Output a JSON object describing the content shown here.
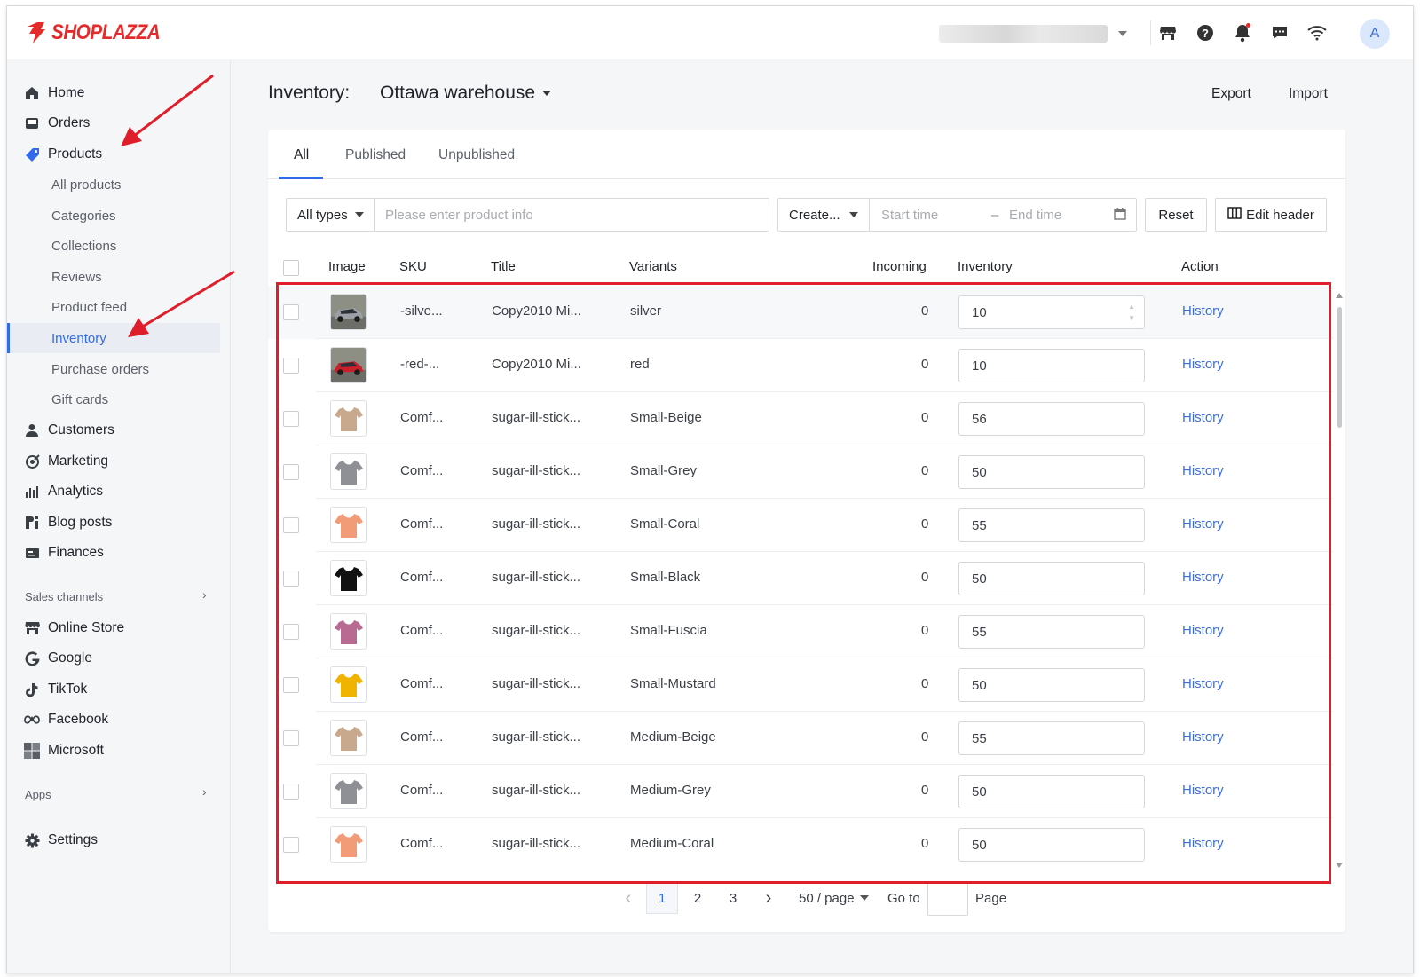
{
  "brand": {
    "name": "SHOPLAZZA",
    "color": "#e52a2a"
  },
  "topbar": {
    "icons": [
      "store-icon",
      "help-icon",
      "bell-icon",
      "chat-icon",
      "wifi-icon"
    ],
    "avatar_initial": "A"
  },
  "sidebar": {
    "main_items": [
      {
        "label": "Home",
        "icon": "home-icon"
      },
      {
        "label": "Orders",
        "icon": "orders-icon"
      },
      {
        "label": "Products",
        "icon": "tag-icon"
      }
    ],
    "product_sub_items": [
      {
        "label": "All products"
      },
      {
        "label": "Categories"
      },
      {
        "label": "Collections"
      },
      {
        "label": "Reviews"
      },
      {
        "label": "Product feed"
      },
      {
        "label": "Inventory",
        "active": true
      },
      {
        "label": "Purchase orders"
      },
      {
        "label": "Gift cards"
      }
    ],
    "other_items": [
      {
        "label": "Customers",
        "icon": "person-icon"
      },
      {
        "label": "Marketing",
        "icon": "marketing-icon"
      },
      {
        "label": "Analytics",
        "icon": "bar-chart-icon"
      },
      {
        "label": "Blog posts",
        "icon": "blog-icon"
      },
      {
        "label": "Finances",
        "icon": "finances-icon"
      }
    ],
    "sales_channels_label": "Sales channels",
    "channels": [
      {
        "label": "Online Store",
        "icon": "store-icon"
      },
      {
        "label": "Google",
        "icon": "google-icon"
      },
      {
        "label": "TikTok",
        "icon": "tiktok-icon"
      },
      {
        "label": "Facebook",
        "icon": "meta-icon"
      },
      {
        "label": "Microsoft",
        "icon": "microsoft-icon"
      }
    ],
    "apps_label": "Apps",
    "settings_label": "Settings"
  },
  "header": {
    "title": "Inventory:",
    "warehouse": "Ottawa warehouse",
    "export_label": "Export",
    "import_label": "Import"
  },
  "tabs": [
    "All",
    "Published",
    "Unpublished"
  ],
  "filters": {
    "type_select": "All types",
    "search_placeholder": "Please enter product info",
    "date_type_select": "Create...",
    "start_placeholder": "Start time",
    "range_separator": "–",
    "end_placeholder": "End time",
    "reset_label": "Reset",
    "edit_header_label": "Edit header"
  },
  "table": {
    "columns": [
      "Image",
      "SKU",
      "Title",
      "Variants",
      "Incoming",
      "Inventory",
      "Action"
    ],
    "rows": [
      {
        "image": "silver-car",
        "sku": "-silve...",
        "title": "Copy2010 Mi...",
        "variant": "silver",
        "incoming": "0",
        "inventory": "10",
        "action": "History"
      },
      {
        "image": "red-car",
        "sku": "-red-...",
        "title": "Copy2010 Mi...",
        "variant": "red",
        "incoming": "0",
        "inventory": "10",
        "action": "History"
      },
      {
        "image": "beige-shirt",
        "sku": "Comf...",
        "title": "sugar-ill-stick...",
        "variant": "Small-Beige",
        "incoming": "0",
        "inventory": "56",
        "action": "History"
      },
      {
        "image": "grey-shirt",
        "sku": "Comf...",
        "title": "sugar-ill-stick...",
        "variant": "Small-Grey",
        "incoming": "0",
        "inventory": "50",
        "action": "History"
      },
      {
        "image": "coral-shirt",
        "sku": "Comf...",
        "title": "sugar-ill-stick...",
        "variant": "Small-Coral",
        "incoming": "0",
        "inventory": "55",
        "action": "History"
      },
      {
        "image": "black-shirt",
        "sku": "Comf...",
        "title": "sugar-ill-stick...",
        "variant": "Small-Black",
        "incoming": "0",
        "inventory": "50",
        "action": "History"
      },
      {
        "image": "fuscia-shirt",
        "sku": "Comf...",
        "title": "sugar-ill-stick...",
        "variant": "Small-Fuscia",
        "incoming": "0",
        "inventory": "55",
        "action": "History"
      },
      {
        "image": "mustard-shirt",
        "sku": "Comf...",
        "title": "sugar-ill-stick...",
        "variant": "Small-Mustard",
        "incoming": "0",
        "inventory": "50",
        "action": "History"
      },
      {
        "image": "beige-shirt",
        "sku": "Comf...",
        "title": "sugar-ill-stick...",
        "variant": "Medium-Beige",
        "incoming": "0",
        "inventory": "55",
        "action": "History"
      },
      {
        "image": "grey-shirt",
        "sku": "Comf...",
        "title": "sugar-ill-stick...",
        "variant": "Medium-Grey",
        "incoming": "0",
        "inventory": "50",
        "action": "History"
      },
      {
        "image": "coral-shirt",
        "sku": "Comf...",
        "title": "sugar-ill-stick...",
        "variant": "Medium-Coral",
        "incoming": "0",
        "inventory": "50",
        "action": "History"
      }
    ]
  },
  "pagination": {
    "pages": [
      "1",
      "2",
      "3"
    ],
    "current": "1",
    "page_size": "50 / page",
    "goto_label": "Go to",
    "page_label": "Page"
  },
  "colors": {
    "accent": "#2f6bea",
    "link": "#3b6fd8",
    "highlight_box": "#e01e2b",
    "shirt_colors": {
      "beige-shirt": "#c9a98e",
      "grey-shirt": "#8f8f96",
      "coral-shirt": "#f29b77",
      "black-shirt": "#111111",
      "fuscia-shirt": "#b86a93",
      "mustard-shirt": "#f0b400"
    }
  }
}
